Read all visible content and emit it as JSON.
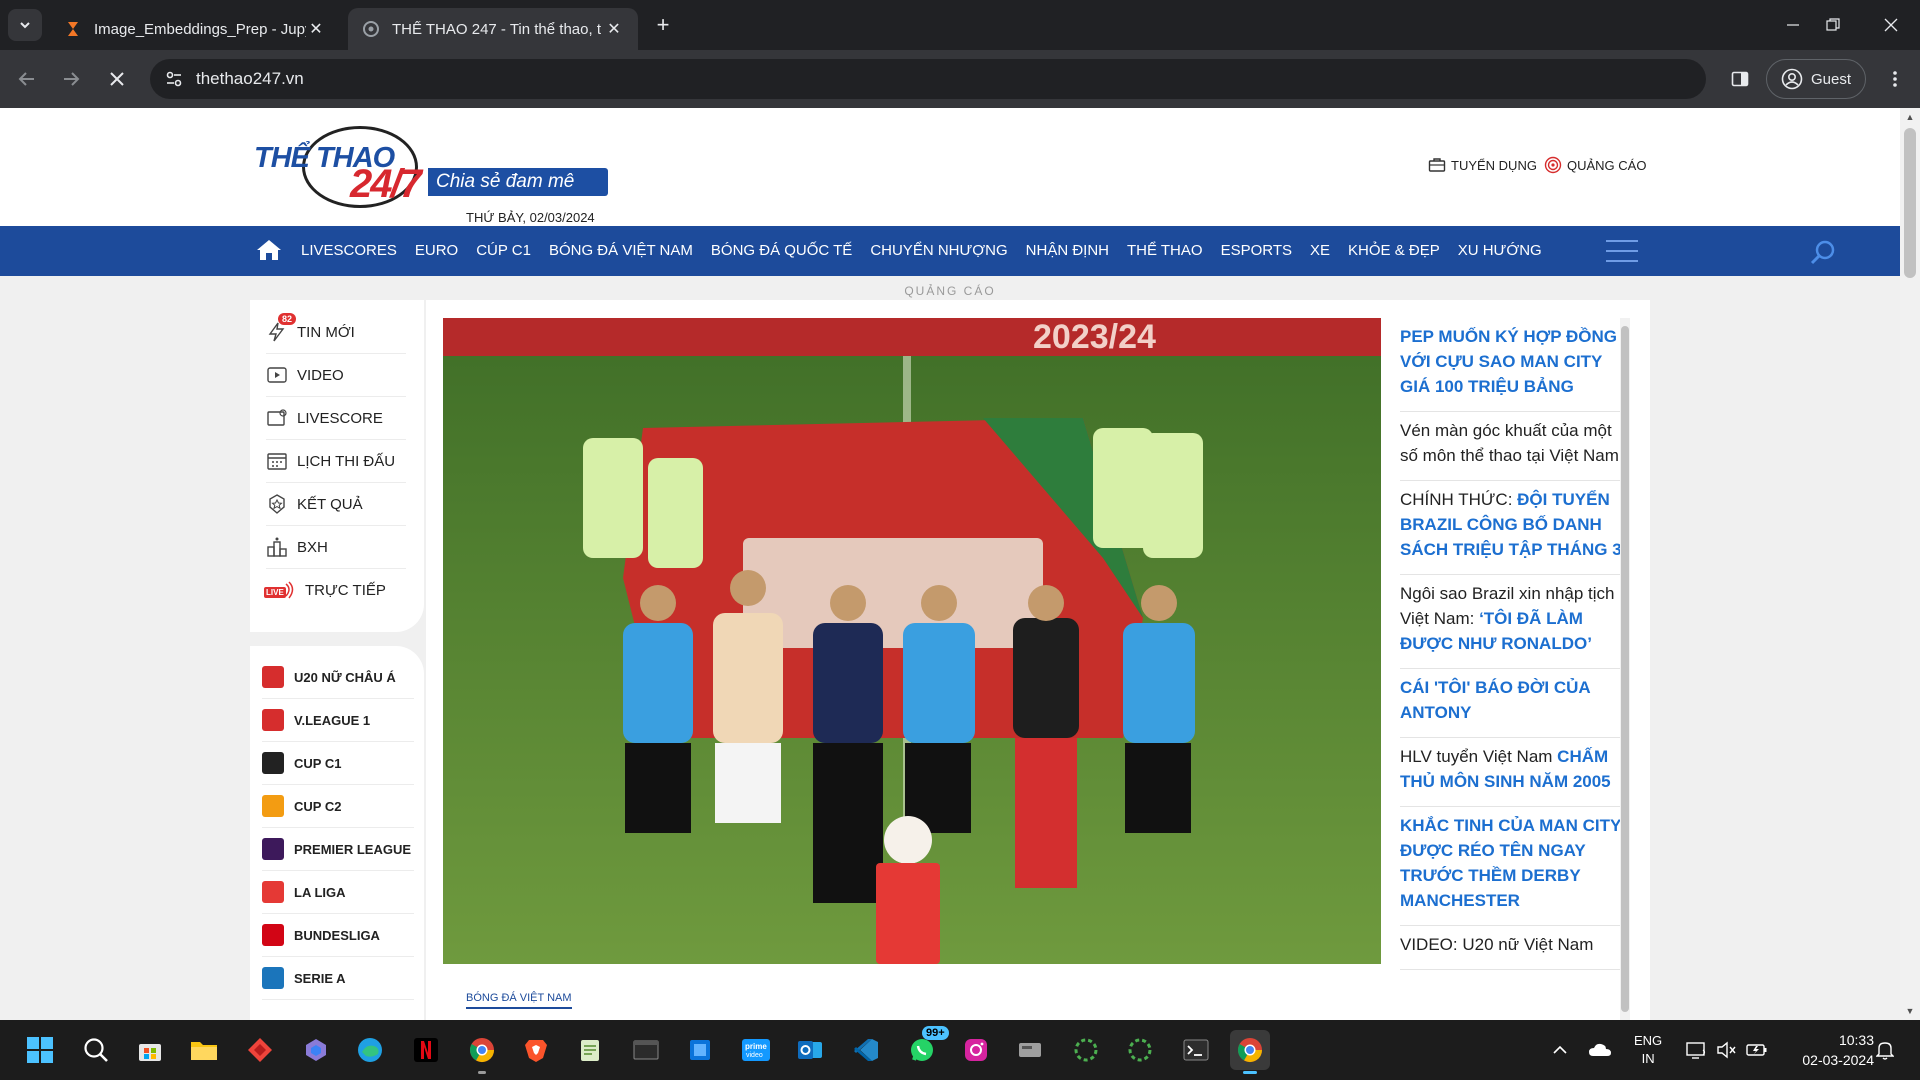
{
  "browser": {
    "tabs": [
      {
        "title": "Image_Embeddings_Prep - Jupy",
        "active": false
      },
      {
        "title": "THỂ THAO 247 - Tin thể thao, t",
        "active": true
      }
    ],
    "new_tab": "+",
    "url": "thethao247.vn",
    "profile": "Guest"
  },
  "site": {
    "logo_the": "THỂ THAO",
    "logo_247": "24/7",
    "slogan": "Chia sẻ đam mê",
    "date": "THỨ BẢY, 02/03/2024",
    "header_links": [
      {
        "label": "TUYỂN DỤNG",
        "icon": "briefcase-icon"
      },
      {
        "label": "QUẢNG CÁO",
        "icon": "target-icon"
      }
    ],
    "nav": [
      "LIVESCORES",
      "EURO",
      "CÚP C1",
      "BÓNG ĐÁ VIỆT NAM",
      "BÓNG ĐÁ QUỐC TẾ",
      "CHUYỂN NHƯỢNG",
      "NHẬN ĐỊNH",
      "THỂ THAO",
      "ESPORTS",
      "XE",
      "KHỎE & ĐẸP",
      "XU HƯỚNG"
    ],
    "ad_label": "QUẢNG CÁO",
    "sidebar": [
      {
        "label": "TIN MỚI",
        "badge": "82"
      },
      {
        "label": "VIDEO"
      },
      {
        "label": "LIVESCORE"
      },
      {
        "label": "LỊCH THI ĐẤU"
      },
      {
        "label": "KẾT QUẢ"
      },
      {
        "label": "BXH"
      },
      {
        "label": "TRỰC TIẾP",
        "live": "LIVE"
      }
    ],
    "leagues": [
      {
        "label": "U20 NỮ CHÂU Á",
        "color": "#d62d2d"
      },
      {
        "label": "V.LEAGUE 1",
        "color": "#d62d2d"
      },
      {
        "label": "CUP C1",
        "color": "#222222"
      },
      {
        "label": "CUP C2",
        "color": "#f39c12"
      },
      {
        "label": "PREMIER LEAGUE",
        "color": "#3d195b"
      },
      {
        "label": "LA LIGA",
        "color": "#e53935"
      },
      {
        "label": "BUNDESLIGA",
        "color": "#d20515"
      },
      {
        "label": "SERIE A",
        "color": "#1b75bb"
      }
    ],
    "hero_category": "BÓNG ĐÁ VIỆT NAM",
    "hero_banner_text": "2023/24",
    "news": [
      {
        "lead": "",
        "hl": "PEP MUỐN KÝ HỢP ĐỒNG VỚI CỰU SAO MAN CITY GIÁ 100 TRIỆU BẢNG"
      },
      {
        "lead": "Vén màn góc khuất của một số môn thể thao tại Việt Nam",
        "hl": ""
      },
      {
        "lead": "CHÍNH THỨC: ",
        "hl": "ĐỘI TUYỂN BRAZIL CÔNG BỐ DANH SÁCH TRIỆU TẬP THÁNG 3"
      },
      {
        "lead": "Ngôi sao Brazil xin nhập tịch Việt Nam: ",
        "hl": "‘TÔI ĐÃ LÀM ĐƯỢC NHƯ RONALDO’"
      },
      {
        "lead": "",
        "hl": "CÁI 'TÔI' BÁO ĐỜI CỦA ANTONY"
      },
      {
        "lead": "HLV tuyển Việt Nam ",
        "hl": "CHẤM THỦ MÔN SINH NĂM 2005"
      },
      {
        "lead": "",
        "hl": "KHẮC TINH CỦA MAN CITY ĐƯỢC RÉO TÊN NGAY TRƯỚC THỀM DERBY MANCHESTER"
      },
      {
        "lead": "VIDEO: U20 nữ Việt Nam",
        "hl": ""
      }
    ]
  },
  "taskbar": {
    "whatsapp_badge": "99+",
    "lang_top": "ENG",
    "lang_bottom": "IN",
    "time": "10:33",
    "date": "02-03-2024"
  }
}
